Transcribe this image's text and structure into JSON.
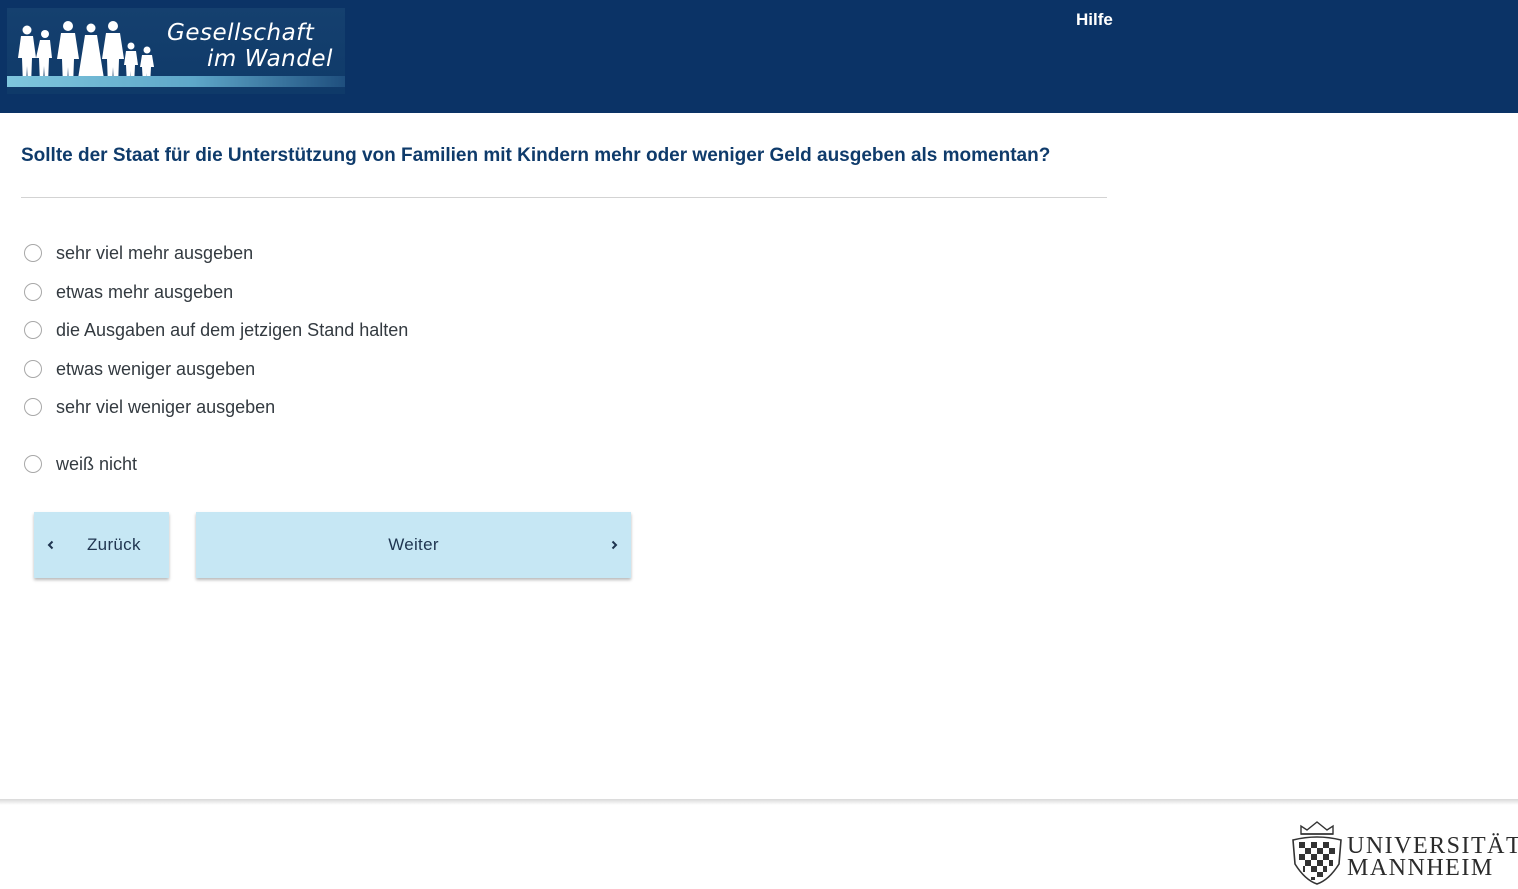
{
  "header": {
    "logo": {
      "line1": "Gesellschaft",
      "line2": "im Wandel"
    },
    "help_label": "Hilfe"
  },
  "question": {
    "text": "Sollte der Staat für die Unterstützung von Familien mit Kindern mehr oder weniger Geld ausgeben als momentan?"
  },
  "options": [
    {
      "label": "sehr viel mehr ausgeben",
      "selected": false
    },
    {
      "label": "etwas mehr ausgeben",
      "selected": false
    },
    {
      "label": "die Ausgaben auf dem jetzigen Stand halten",
      "selected": false
    },
    {
      "label": "etwas weniger ausgeben",
      "selected": false
    },
    {
      "label": "sehr viel weniger ausgeben",
      "selected": false
    },
    {
      "label": "weiß nicht",
      "selected": false
    }
  ],
  "navigation": {
    "back_label": "Zurück",
    "next_label": "Weiter"
  },
  "footer": {
    "university": {
      "line1": "UNIVERSITÄT",
      "line2": "MANNHEIM"
    }
  },
  "colors": {
    "header_bg": "#0b3366",
    "question_text": "#0f3b6b",
    "button_bg": "#c6e7f4"
  },
  "icons": {
    "back": "chevron-left-icon",
    "next": "chevron-right-icon"
  }
}
